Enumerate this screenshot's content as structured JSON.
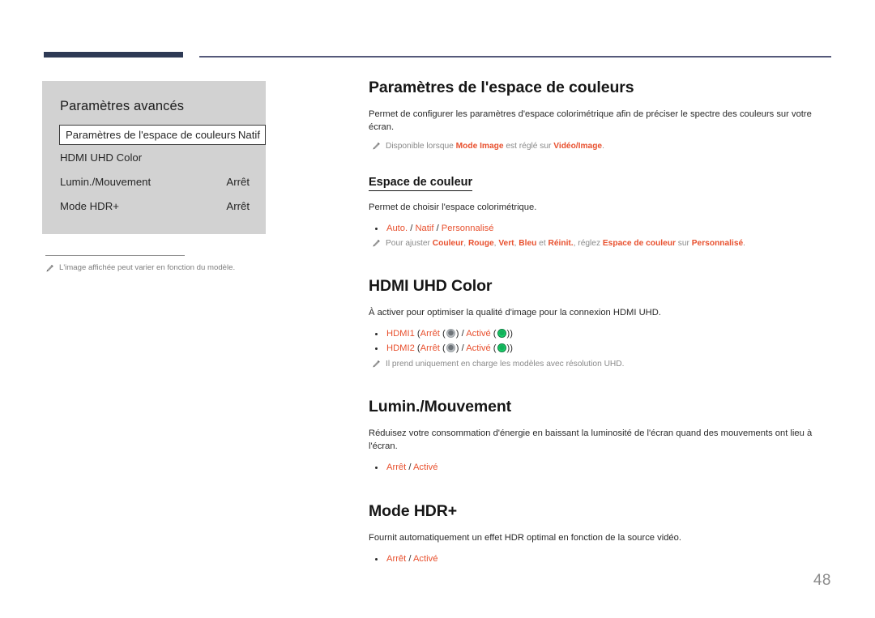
{
  "header": {
    "thick_rule_color": "#2e3a55",
    "thin_rule_color": "#55597a"
  },
  "osd": {
    "title": "Paramètres avancés",
    "rows": [
      {
        "label": "Paramètres de l'espace de couleurs",
        "value": "Natif",
        "selected": true
      },
      {
        "label": "HDMI UHD Color",
        "value": "",
        "selected": false
      },
      {
        "label": "Lumin./Mouvement",
        "value": "Arrêt",
        "selected": false
      },
      {
        "label": "Mode HDR+",
        "value": "Arrêt",
        "selected": false
      }
    ]
  },
  "left_note": {
    "icon": "pencil-icon",
    "text": "L'image affichée peut varier en fonction du modèle."
  },
  "sections": {
    "color_space": {
      "title": "Paramètres de l'espace de couleurs",
      "body": "Permet de configurer les paramètres d'espace colorimétrique afin de préciser le spectre des couleurs sur votre écran.",
      "note": {
        "pre": "Disponible lorsque ",
        "term1": "Mode Image",
        "mid": " est réglé sur ",
        "term2": "Vidéo/Image",
        "post": "."
      },
      "sub_title": "Espace de couleur",
      "sub_body": "Permet de choisir l'espace colorimétrique.",
      "options": {
        "opt1": "Auto.",
        "sep1": " / ",
        "opt2": "Natif",
        "sep2": " / ",
        "opt3": "Personnalisé"
      },
      "sub_note": {
        "pre": "Pour ajuster ",
        "t1": "Couleur",
        "c1": ", ",
        "t2": "Rouge",
        "c2": ", ",
        "t3": "Vert",
        "c3": ", ",
        "t4": "Bleu",
        "c4": " et ",
        "t5": "Réinit.",
        "c5": ", réglez ",
        "t6": "Espace de couleur",
        "c6": " sur ",
        "t7": "Personnalisé",
        "c7": "."
      }
    },
    "hdmi_uhd": {
      "title": "HDMI UHD Color",
      "body": "À activer pour optimiser la qualité d'image pour la connexion HDMI UHD.",
      "items": [
        {
          "port": "HDMI1",
          "open": " (",
          "off_label": "Arrêt",
          "off_icon": "led-off-icon",
          "sep": " / ",
          "on_label": "Activé",
          "on_icon": "led-on-icon",
          "close": ")"
        },
        {
          "port": "HDMI2",
          "open": " (",
          "off_label": "Arrêt",
          "off_icon": "led-off-icon",
          "sep": " / ",
          "on_label": "Activé",
          "on_icon": "led-on-icon",
          "close": ")"
        }
      ],
      "note": "Il prend uniquement en charge les modèles avec résolution UHD."
    },
    "lumin": {
      "title": "Lumin./Mouvement",
      "body": "Réduisez votre consommation d'énergie en baissant la luminosité de l'écran quand des mouvements ont lieu à l'écran.",
      "options": {
        "opt1": "Arrêt",
        "sep1": " / ",
        "opt2": "Activé"
      }
    },
    "hdr_plus": {
      "title": "Mode HDR+",
      "body": "Fournit automatiquement un effet HDR optimal en fonction de la source vidéo.",
      "options": {
        "opt1": "Arrêt",
        "sep1": " / ",
        "opt2": "Activé"
      }
    }
  },
  "footer": {
    "page_number": "48"
  },
  "colors": {
    "accent": "#e8502e",
    "navy": "#2e3a55",
    "panel_bg": "#d2d2d2",
    "note_grey": "#8a8a8a",
    "led_on": "#17d169",
    "led_off": "#6e7479"
  }
}
